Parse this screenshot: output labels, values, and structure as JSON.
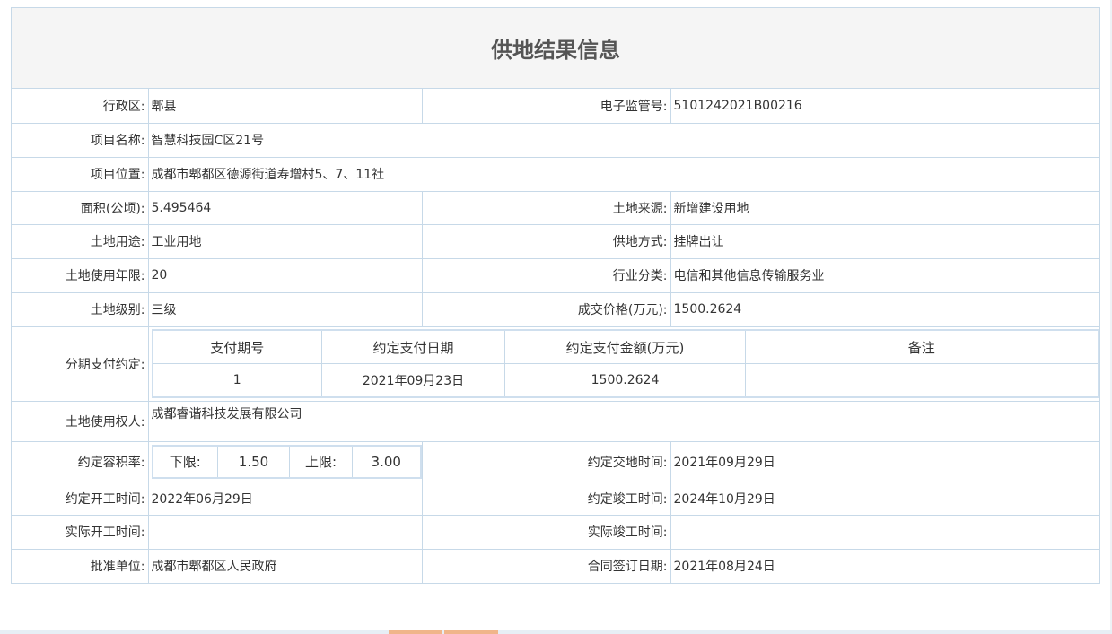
{
  "title": "供地结果信息",
  "fields": {
    "district_label": "行政区:",
    "district": "郫县",
    "supervision_label": "电子监管号:",
    "supervision_no": "5101242021B00216",
    "project_name_label": "项目名称:",
    "project_name": "智慧科技园C区21号",
    "location_label": "项目位置:",
    "location": "成都市郫都区德源街道寿增村5、7、11社",
    "area_label": "面积(公顷):",
    "area": "5.495464",
    "source_label": "土地来源:",
    "source": "新增建设用地",
    "use_label": "土地用途:",
    "use": "工业用地",
    "supply_label": "供地方式:",
    "supply": "挂牌出让",
    "term_label": "土地使用年限:",
    "term": "20",
    "industry_label": "行业分类:",
    "industry": "电信和其他信息传输服务业",
    "grade_label": "土地级别:",
    "grade": "三级",
    "price_label": "成交价格(万元):",
    "price": "1500.2624",
    "installment_label": "分期支付约定:",
    "owner_label": "土地使用权人:",
    "owner": "成都睿谐科技发展有限公司",
    "far_label": "约定容积率:",
    "far_lower_label": "下限:",
    "far_lower": "1.50",
    "far_upper_label": "上限:",
    "far_upper": "3.00",
    "handover_label": "约定交地时间:",
    "handover": "2021年09月29日",
    "start_label": "约定开工时间:",
    "start": "2022年06月29日",
    "finish_label": "约定竣工时间:",
    "finish": "2024年10月29日",
    "actual_start_label": "实际开工时间:",
    "actual_start": "",
    "actual_finish_label": "实际竣工时间:",
    "actual_finish": "",
    "approver_label": "批准单位:",
    "approver": "成都市郫都区人民政府",
    "contract_label": "合同签订日期:",
    "contract": "2021年08月24日"
  },
  "installments": {
    "headers": [
      "支付期号",
      "约定支付日期",
      "约定支付金额(万元)",
      "备注"
    ],
    "rows": [
      [
        "1",
        "2021年09月23日",
        "1500.2624",
        ""
      ]
    ]
  }
}
